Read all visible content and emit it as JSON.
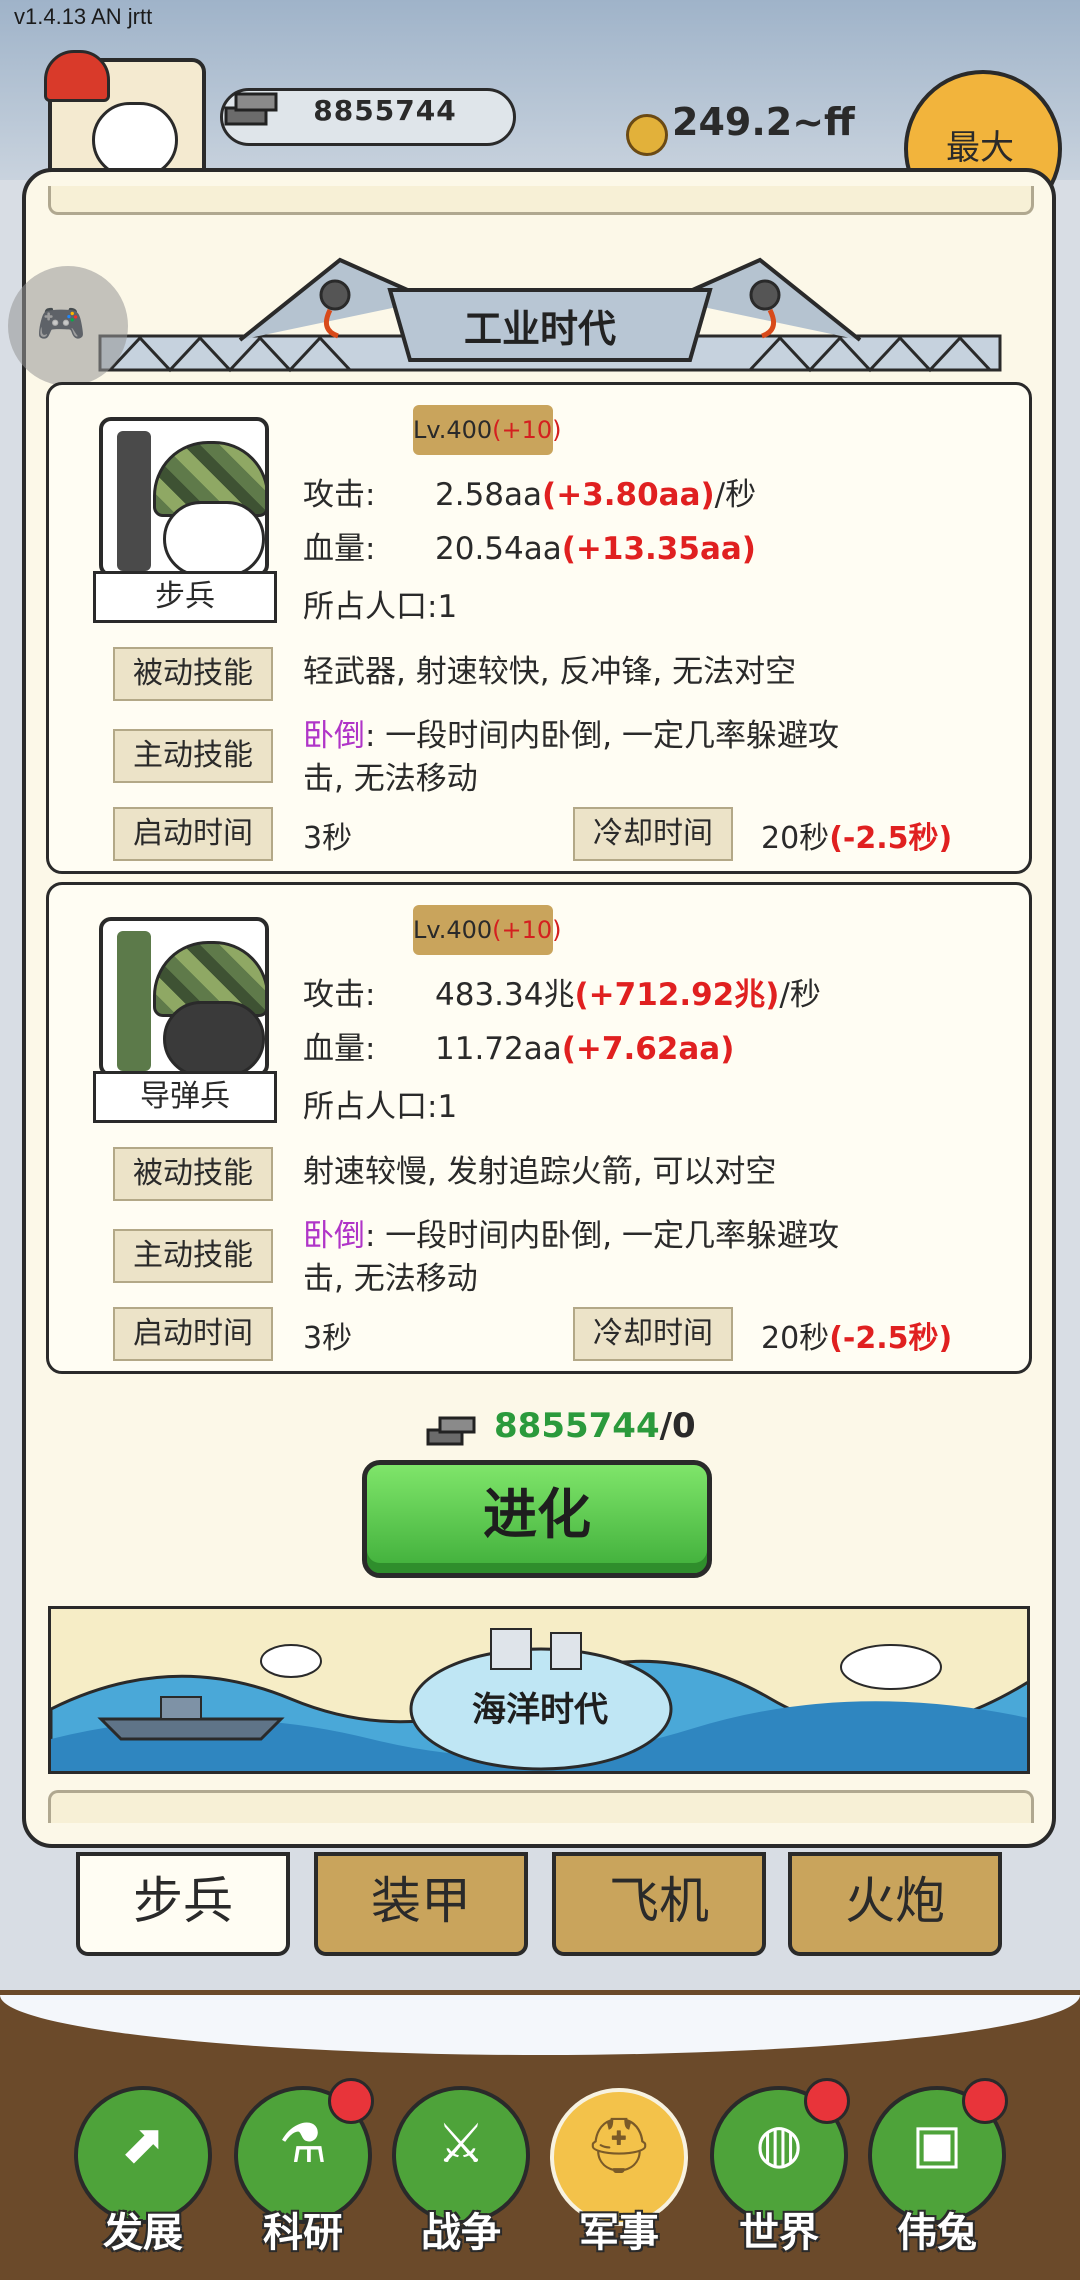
{
  "version": "v1.4.13 AN jrtt",
  "header": {
    "iron_amount": "8855744",
    "coin_amount": "249.2~ff",
    "max_button": "最大"
  },
  "era": {
    "current_title": "工业时代",
    "next_title": "海洋时代"
  },
  "units": [
    {
      "name": "步兵",
      "level": "Lv.400",
      "level_plus": "(+10)",
      "attack_label": "攻击:",
      "attack_value": "2.58aa",
      "attack_bonus": "(+3.80aa)",
      "attack_unit": "/秒",
      "hp_label": "血量:",
      "hp_value": "20.54aa",
      "hp_bonus": "(+13.35aa)",
      "population": "所占人口:1",
      "passive_label": "被动技能",
      "passive_text": "轻武器, 射速较快, 反冲锋, 无法对空",
      "active_label": "主动技能",
      "active_skill_name": "卧倒",
      "active_text_line1": ": 一段时间内卧倒, 一定几率躲避攻",
      "active_text_line2": "击, 无法移动",
      "start_label": "启动时间",
      "start_value": "3秒",
      "cooldown_label": "冷却时间",
      "cooldown_value": "20秒",
      "cooldown_bonus": "(-2.5秒)"
    },
    {
      "name": "导弹兵",
      "level": "Lv.400",
      "level_plus": "(+10)",
      "attack_label": "攻击:",
      "attack_value": "483.34兆",
      "attack_bonus": "(+712.92兆)",
      "attack_unit": "/秒",
      "hp_label": "血量:",
      "hp_value": "11.72aa",
      "hp_bonus": "(+7.62aa)",
      "population": "所占人口:1",
      "passive_label": "被动技能",
      "passive_text": "射速较慢, 发射追踪火箭, 可以对空",
      "active_label": "主动技能",
      "active_skill_name": "卧倒",
      "active_text_line1": ": 一段时间内卧倒, 一定几率躲避攻",
      "active_text_line2": "击, 无法移动",
      "start_label": "启动时间",
      "start_value": "3秒",
      "cooldown_label": "冷却时间",
      "cooldown_value": "20秒",
      "cooldown_bonus": "(-2.5秒)"
    }
  ],
  "evolve": {
    "cost_have": "8855744",
    "cost_sep": "/0",
    "button": "进化"
  },
  "tabs": [
    "步兵",
    "装甲",
    "飞机",
    "火炮"
  ],
  "nav": [
    {
      "label": "发展",
      "icon": "arrow-up-icon",
      "badge": false
    },
    {
      "label": "科研",
      "icon": "flask-icon",
      "badge": true
    },
    {
      "label": "战争",
      "icon": "crossed-swords-icon",
      "badge": false
    },
    {
      "label": "军事",
      "icon": "helmet-icon",
      "badge": false,
      "active": true
    },
    {
      "label": "世界",
      "icon": "globe-icon",
      "badge": true
    },
    {
      "label": "伟兔",
      "icon": "rabbit-portrait-icon",
      "badge": true
    }
  ],
  "colors": {
    "accent_green": "#3fae3a",
    "bonus_red": "#e02020",
    "skill_purple": "#b035c8",
    "tab_gold": "#c9a45c"
  }
}
